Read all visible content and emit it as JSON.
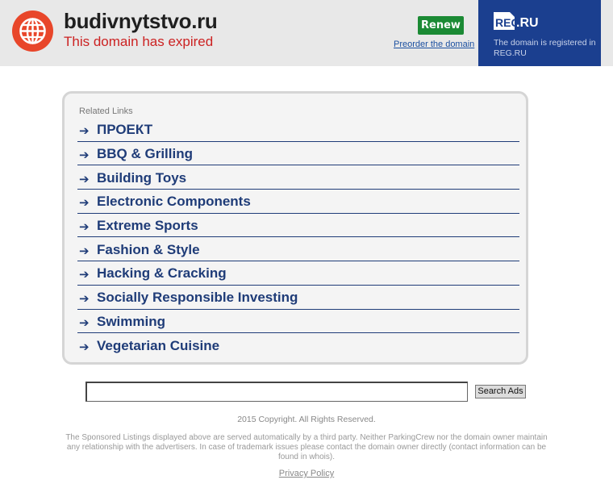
{
  "header": {
    "domain": "budivnytstvo.ru",
    "status": "This domain has expired",
    "renew_label": "Renew",
    "preorder_label": "Preorder the domain",
    "registrar": {
      "logo_text": "REG.RU",
      "note": "The domain is registered in REG.RU"
    },
    "globe_icon": "globe-icon"
  },
  "related": {
    "title": "Related Links",
    "links": [
      "ПРОЕКТ",
      "BBQ & Grilling",
      "Building Toys",
      "Electronic Components",
      "Extreme Sports",
      "Fashion & Style",
      "Hacking & Cracking",
      "Socially Responsible Investing",
      "Swimming",
      "Vegetarian Cuisine"
    ],
    "arrow_glyph": "➔"
  },
  "search": {
    "value": "",
    "button_label": "Search Ads"
  },
  "footer": {
    "copyright": "2015 Copyright. All Rights Reserved.",
    "disclaimer": "The Sponsored Listings displayed above are served automatically by a third party. Neither ParkingCrew nor the domain owner maintain any relationship with the advertisers. In case of trademark issues please contact the domain owner directly (contact information can be found in whois).",
    "privacy_label": "Privacy Policy"
  },
  "colors": {
    "header_bg": "#e8e8e8",
    "expired_red": "#cc2222",
    "renew_green": "#1b8a34",
    "regru_blue": "#1b3f8f",
    "link_navy": "#1f3c78",
    "globe_red": "#e8462a"
  }
}
